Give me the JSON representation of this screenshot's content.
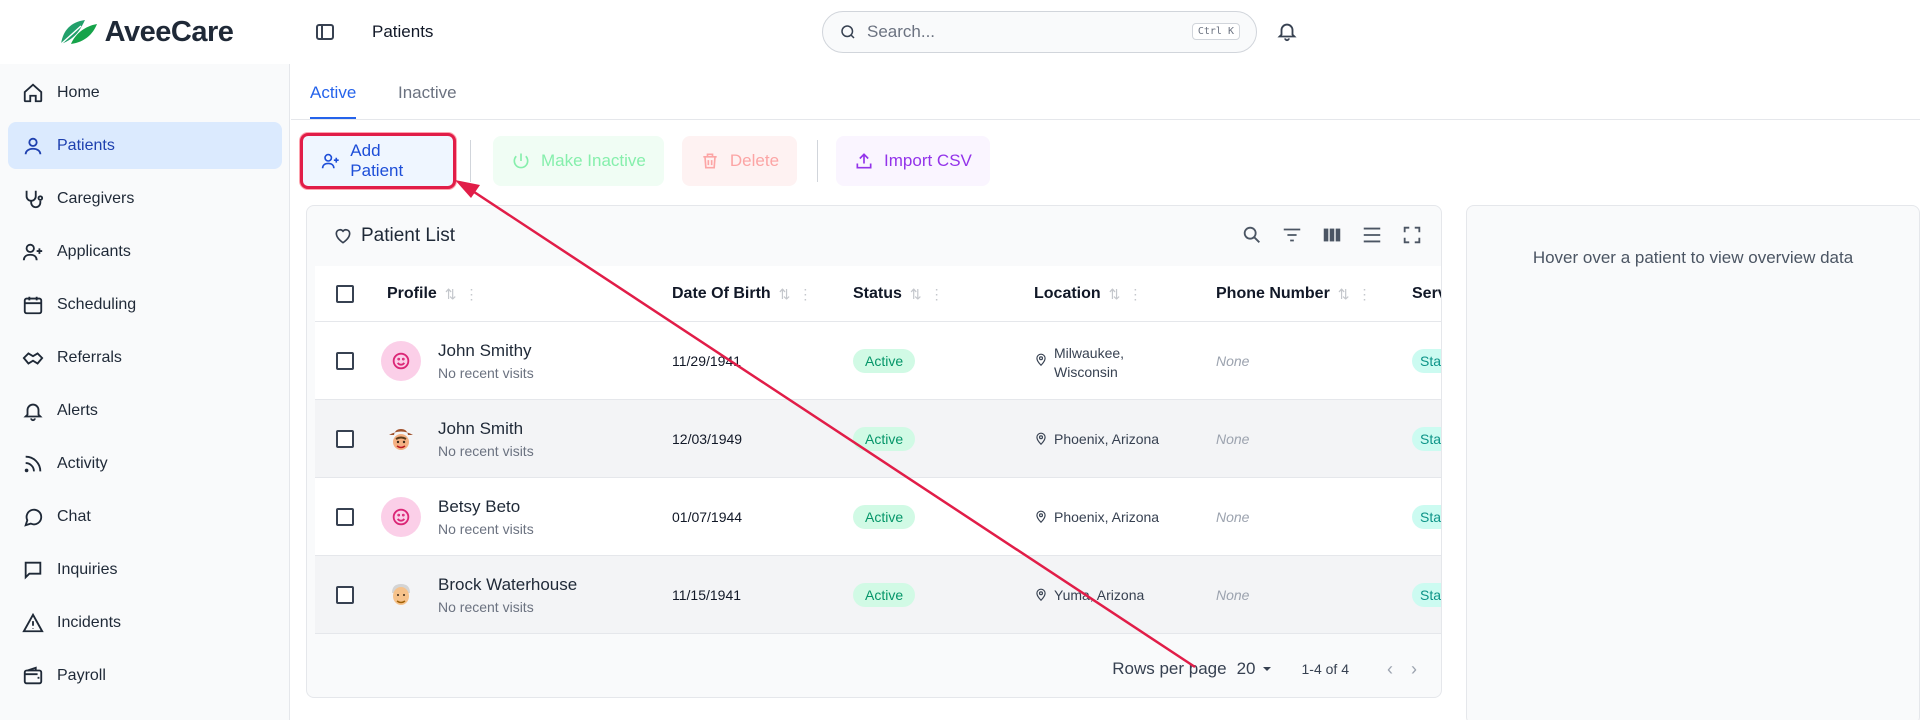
{
  "brand": {
    "name": "AveeCare"
  },
  "sidebar": {
    "items": [
      {
        "label": "Home",
        "icon": "home-icon",
        "active": false
      },
      {
        "label": "Patients",
        "icon": "user-icon",
        "active": true
      },
      {
        "label": "Caregivers",
        "icon": "stethoscope-icon",
        "active": false
      },
      {
        "label": "Applicants",
        "icon": "user-plus-icon",
        "active": false
      },
      {
        "label": "Scheduling",
        "icon": "calendar-icon",
        "active": false
      },
      {
        "label": "Referrals",
        "icon": "handshake-icon",
        "active": false
      },
      {
        "label": "Alerts",
        "icon": "bell-icon",
        "active": false
      },
      {
        "label": "Activity",
        "icon": "rss-icon",
        "active": false
      },
      {
        "label": "Chat",
        "icon": "chat-icon",
        "active": false
      },
      {
        "label": "Inquiries",
        "icon": "message-square-icon",
        "active": false
      },
      {
        "label": "Incidents",
        "icon": "warning-icon",
        "active": false
      },
      {
        "label": "Payroll",
        "icon": "wallet-icon",
        "active": false
      }
    ]
  },
  "header": {
    "title": "Patients",
    "search_placeholder": "Search...",
    "search_shortcut": "Ctrl K"
  },
  "tabs": [
    {
      "label": "Active",
      "active": true
    },
    {
      "label": "Inactive",
      "active": false
    }
  ],
  "toolbar": {
    "add_label": "Add Patient",
    "inactive_label": "Make Inactive",
    "delete_label": "Delete",
    "import_label": "Import CSV"
  },
  "patient_list": {
    "title": "Patient List",
    "columns": {
      "profile": "Profile",
      "dob": "Date Of Birth",
      "status": "Status",
      "location": "Location",
      "phone": "Phone Number",
      "service": "Serv"
    },
    "rows": [
      {
        "name": "John Smithy",
        "sub": "No recent visits",
        "dob": "11/29/1941",
        "status": "Active",
        "location_line1": "Milwaukee,",
        "location_line2": "Wisconsin",
        "phone": "None",
        "service": "Sta",
        "avatar": "smile-face"
      },
      {
        "name": "John Smith",
        "sub": "No recent visits",
        "dob": "12/03/1949",
        "status": "Active",
        "location_line1": "Phoenix, Arizona",
        "location_line2": "",
        "phone": "None",
        "service": "Sta",
        "avatar": "cowboy-emoji"
      },
      {
        "name": "Betsy Beto",
        "sub": "No recent visits",
        "dob": "01/07/1944",
        "status": "Active",
        "location_line1": "Phoenix, Arizona",
        "location_line2": "",
        "phone": "None",
        "service": "Sta",
        "avatar": "smile-face"
      },
      {
        "name": "Brock Waterhouse",
        "sub": "No recent visits",
        "dob": "11/15/1941",
        "status": "Active",
        "location_line1": "Yuma, Arizona",
        "location_line2": "",
        "phone": "None",
        "service": "Sta",
        "avatar": "elder-emoji"
      }
    ],
    "footer": {
      "rows_per_page_label": "Rows per page",
      "rows_per_page_value": "20",
      "range": "1-4 of 4"
    }
  },
  "overview": {
    "text": "Hover over a patient to view overview data"
  },
  "colors": {
    "accent": "#2563eb",
    "annotation": "#e11d48",
    "active_badge": "#059669"
  }
}
